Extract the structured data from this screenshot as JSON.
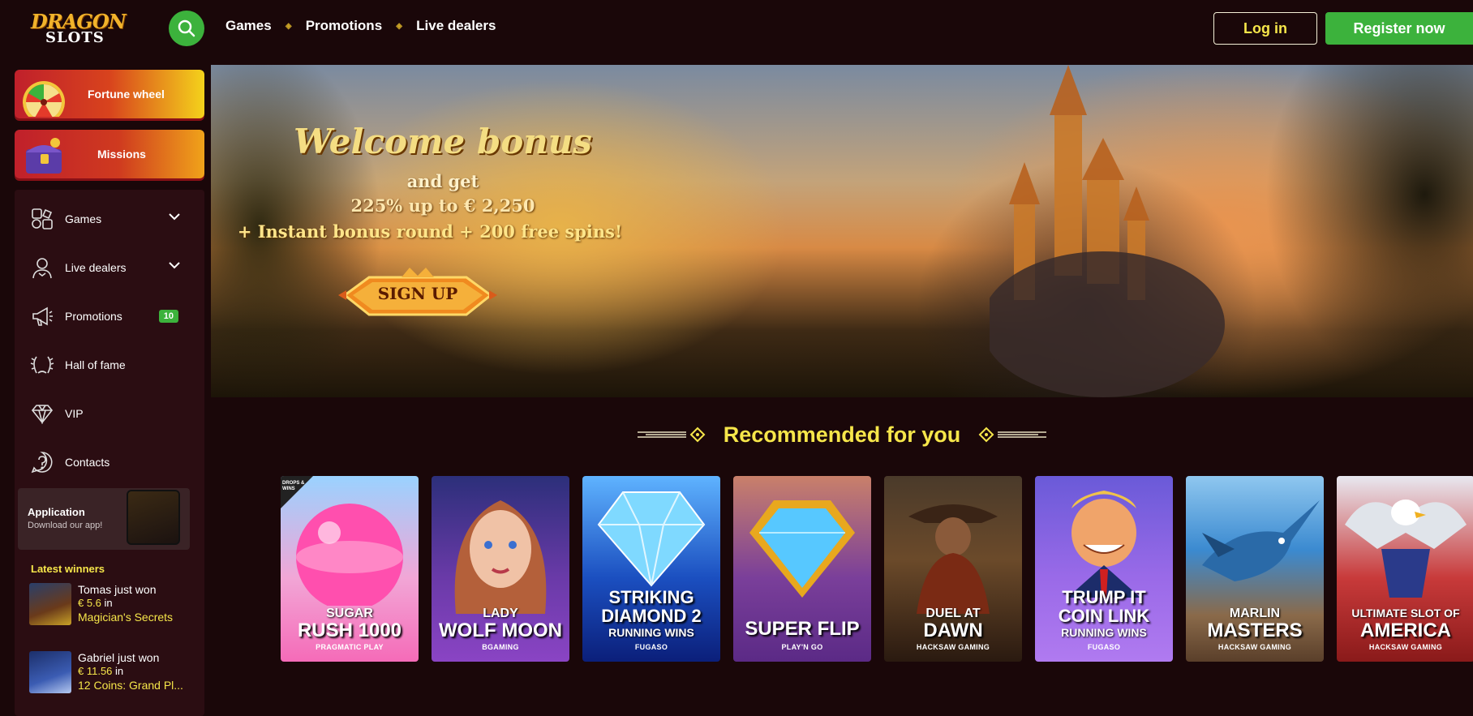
{
  "brand": {
    "logo_line1": "DRAGON",
    "logo_line2": "SLOTS"
  },
  "nav": {
    "items": [
      "Games",
      "Promotions",
      "Live dealers"
    ]
  },
  "auth": {
    "login": "Log in",
    "register": "Register now"
  },
  "sidebar": {
    "promos": [
      {
        "label": "Fortune wheel"
      },
      {
        "label": "Missions"
      }
    ],
    "menu": [
      {
        "label": "Games",
        "icon": "games-icon"
      },
      {
        "label": "Live dealers",
        "icon": "live-dealer-icon"
      },
      {
        "label": "Promotions",
        "icon": "megaphone-icon",
        "badge": "10"
      },
      {
        "label": "Hall of fame",
        "icon": "laurel-icon"
      },
      {
        "label": "VIP",
        "icon": "diamond-icon"
      },
      {
        "label": "Contacts",
        "icon": "question-icon"
      }
    ],
    "app": {
      "title": "Application",
      "subtitle": "Download our app!"
    },
    "winners_title": "Latest winners",
    "winners": [
      {
        "who": "Tomas just won",
        "amount": "€ 5.6",
        "in": "in",
        "game": "Magician's Secrets"
      },
      {
        "who": "Gabriel just won",
        "amount": "€ 11.56",
        "in": "in",
        "game": "12 Coins: Grand Pl..."
      }
    ]
  },
  "banner": {
    "title": "Welcome bonus",
    "line2": "and get",
    "line3": "225% up to € 2,250",
    "line4": "+ Instant bonus round + 200 free spins!",
    "cta": "SIGN UP"
  },
  "recommended": {
    "title": "Recommended for you",
    "games": [
      {
        "line1": "SUGAR",
        "line2": "RUSH 1000",
        "provider": "PRAGMATIC PLAY",
        "badge": "DROPS & WINS"
      },
      {
        "line1": "LADY",
        "line2": "WOLF MOON",
        "provider": "BGAMING"
      },
      {
        "line1": "STRIKING",
        "line2": "DIAMOND 2",
        "line3": "RUNNING WINS",
        "provider": "FUGASO"
      },
      {
        "line1": "",
        "line2": "SUPER FLIP",
        "provider": "PLAY'N GO"
      },
      {
        "line1": "DUEL AT",
        "line2": "DAWN",
        "provider": "HACKSAW GAMING"
      },
      {
        "line1": "TRUMP IT",
        "line2": "COIN LINK",
        "line3": "RUNNING WINS",
        "provider": "FUGASO"
      },
      {
        "line1": "MARLIN",
        "line2": "MASTERS",
        "provider": "HACKSAW GAMING"
      },
      {
        "line1": "ULTIMATE SLOT OF",
        "line2": "AMERICA",
        "provider": "HACKSAW GAMING"
      }
    ]
  },
  "colors": {
    "background": "#1a0709",
    "accent_green": "#3cb23c",
    "accent_yellow": "#f6e64a",
    "panel": "#2b0d12"
  }
}
